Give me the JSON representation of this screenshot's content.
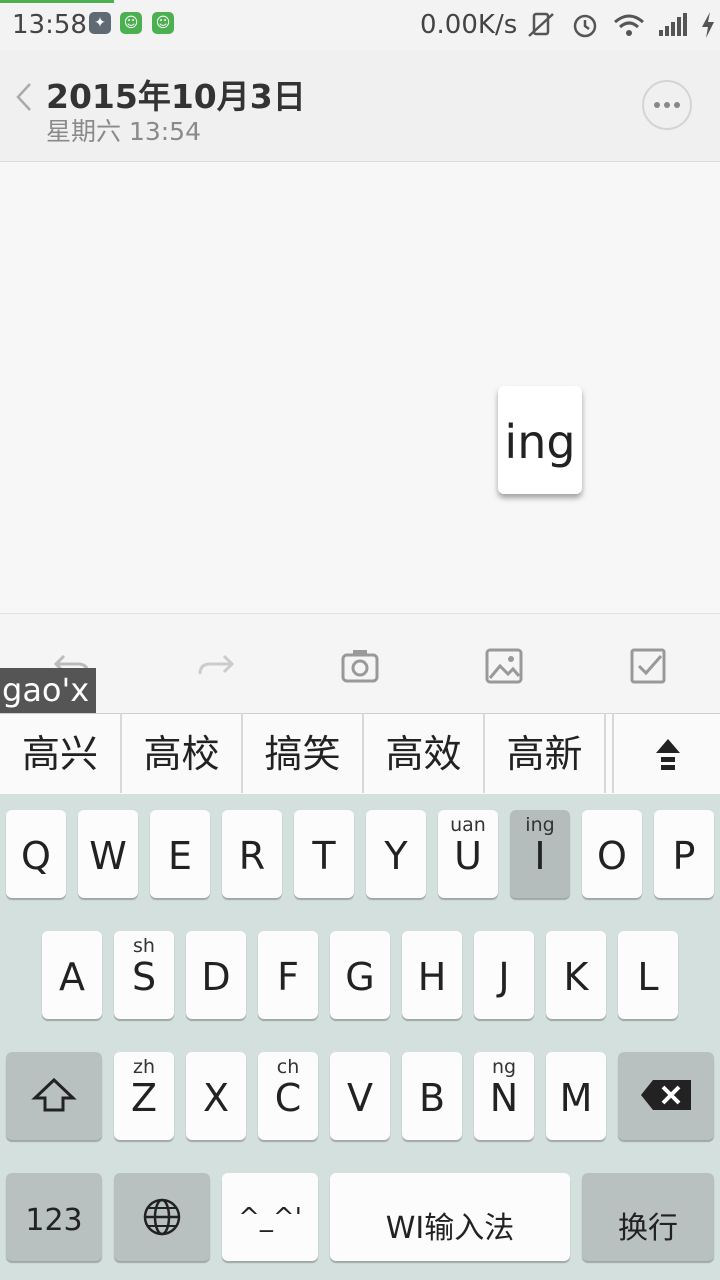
{
  "status": {
    "time": "13:58",
    "speed": "0.00K/s"
  },
  "header": {
    "title": "2015年10月3日",
    "subtitle": "星期六 13:54"
  },
  "editor": {
    "key_preview": "ing"
  },
  "ime": {
    "composing": "gao'x",
    "candidates": [
      "高兴",
      "高校",
      "搞笑",
      "高效",
      "高新"
    ]
  },
  "keyboard": {
    "row1": [
      {
        "k": "Q",
        "h": ""
      },
      {
        "k": "W",
        "h": ""
      },
      {
        "k": "E",
        "h": ""
      },
      {
        "k": "R",
        "h": ""
      },
      {
        "k": "T",
        "h": ""
      },
      {
        "k": "Y",
        "h": ""
      },
      {
        "k": "U",
        "h": "uan"
      },
      {
        "k": "I",
        "h": "ing"
      },
      {
        "k": "O",
        "h": ""
      },
      {
        "k": "P",
        "h": ""
      }
    ],
    "row2": [
      {
        "k": "A",
        "h": ""
      },
      {
        "k": "S",
        "h": "sh"
      },
      {
        "k": "D",
        "h": ""
      },
      {
        "k": "F",
        "h": ""
      },
      {
        "k": "G",
        "h": ""
      },
      {
        "k": "H",
        "h": ""
      },
      {
        "k": "J",
        "h": ""
      },
      {
        "k": "K",
        "h": ""
      },
      {
        "k": "L",
        "h": ""
      }
    ],
    "row3": [
      {
        "k": "Z",
        "h": "zh"
      },
      {
        "k": "X",
        "h": ""
      },
      {
        "k": "C",
        "h": "ch"
      },
      {
        "k": "V",
        "h": ""
      },
      {
        "k": "B",
        "h": ""
      },
      {
        "k": "N",
        "h": "ng"
      },
      {
        "k": "M",
        "h": ""
      }
    ],
    "numbers_label": "123",
    "emoticon_label": "^_^'",
    "space_label": "WI输入法",
    "enter_label": "换行"
  },
  "colors": {
    "keyboard_bg": "#d4e0dd",
    "accent_green": "#4caf50"
  }
}
